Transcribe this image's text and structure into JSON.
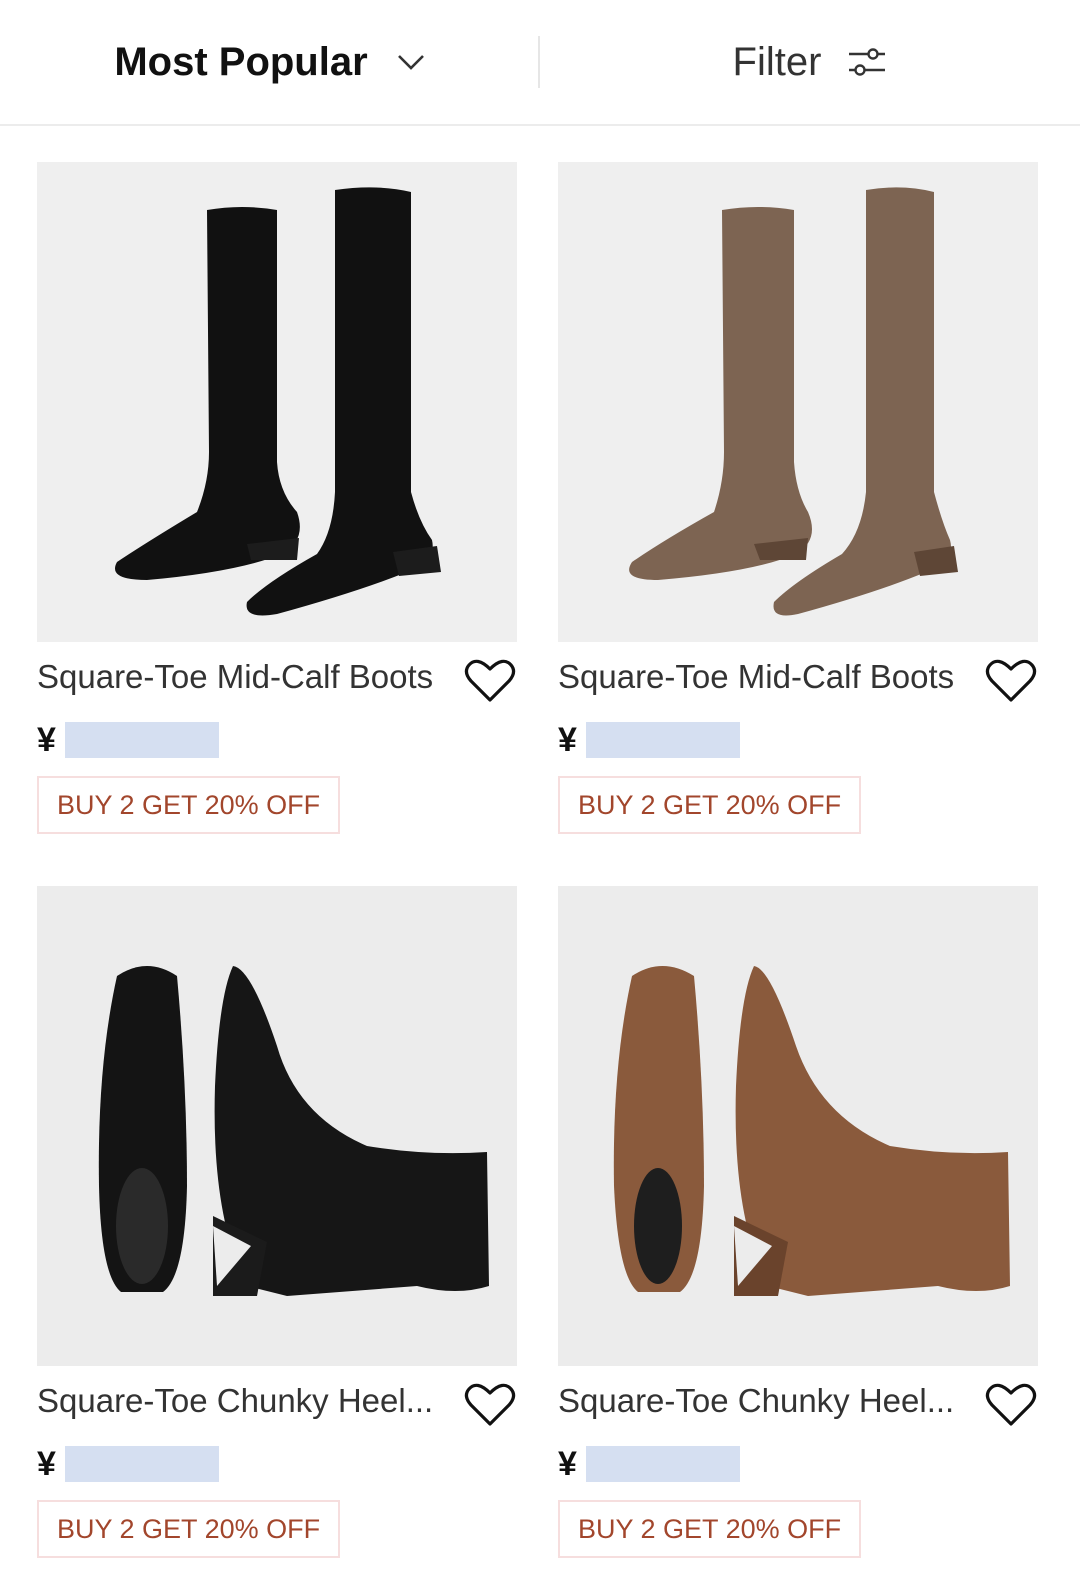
{
  "sort": {
    "label": "Most Popular",
    "icon": "chevron-down-icon"
  },
  "filter": {
    "label": "Filter",
    "icon": "sliders-icon"
  },
  "products": [
    {
      "title": "Square-Toe Mid-Calf Boots",
      "price_prefix": "¥",
      "promo": "BUY 2 GET 20% OFF",
      "color": "#111111"
    },
    {
      "title": "Square-Toe Mid-Calf Boots",
      "price_prefix": "¥",
      "promo": "BUY 2 GET 20% OFF",
      "color": "#7d6452"
    },
    {
      "title": "Square-Toe Chunky Heel...",
      "price_prefix": "¥",
      "promo": "BUY 2 GET 20% OFF",
      "color": "#141414"
    },
    {
      "title": "Square-Toe Chunky Heel...",
      "price_prefix": "¥",
      "promo": "BUY 2 GET 20% OFF",
      "color": "#8a5a3c"
    }
  ],
  "colors": {
    "promo_text": "#a2462c",
    "promo_border": "#f6dede",
    "price_mask": "#d5dff1",
    "photo_bg": "#efefef"
  }
}
